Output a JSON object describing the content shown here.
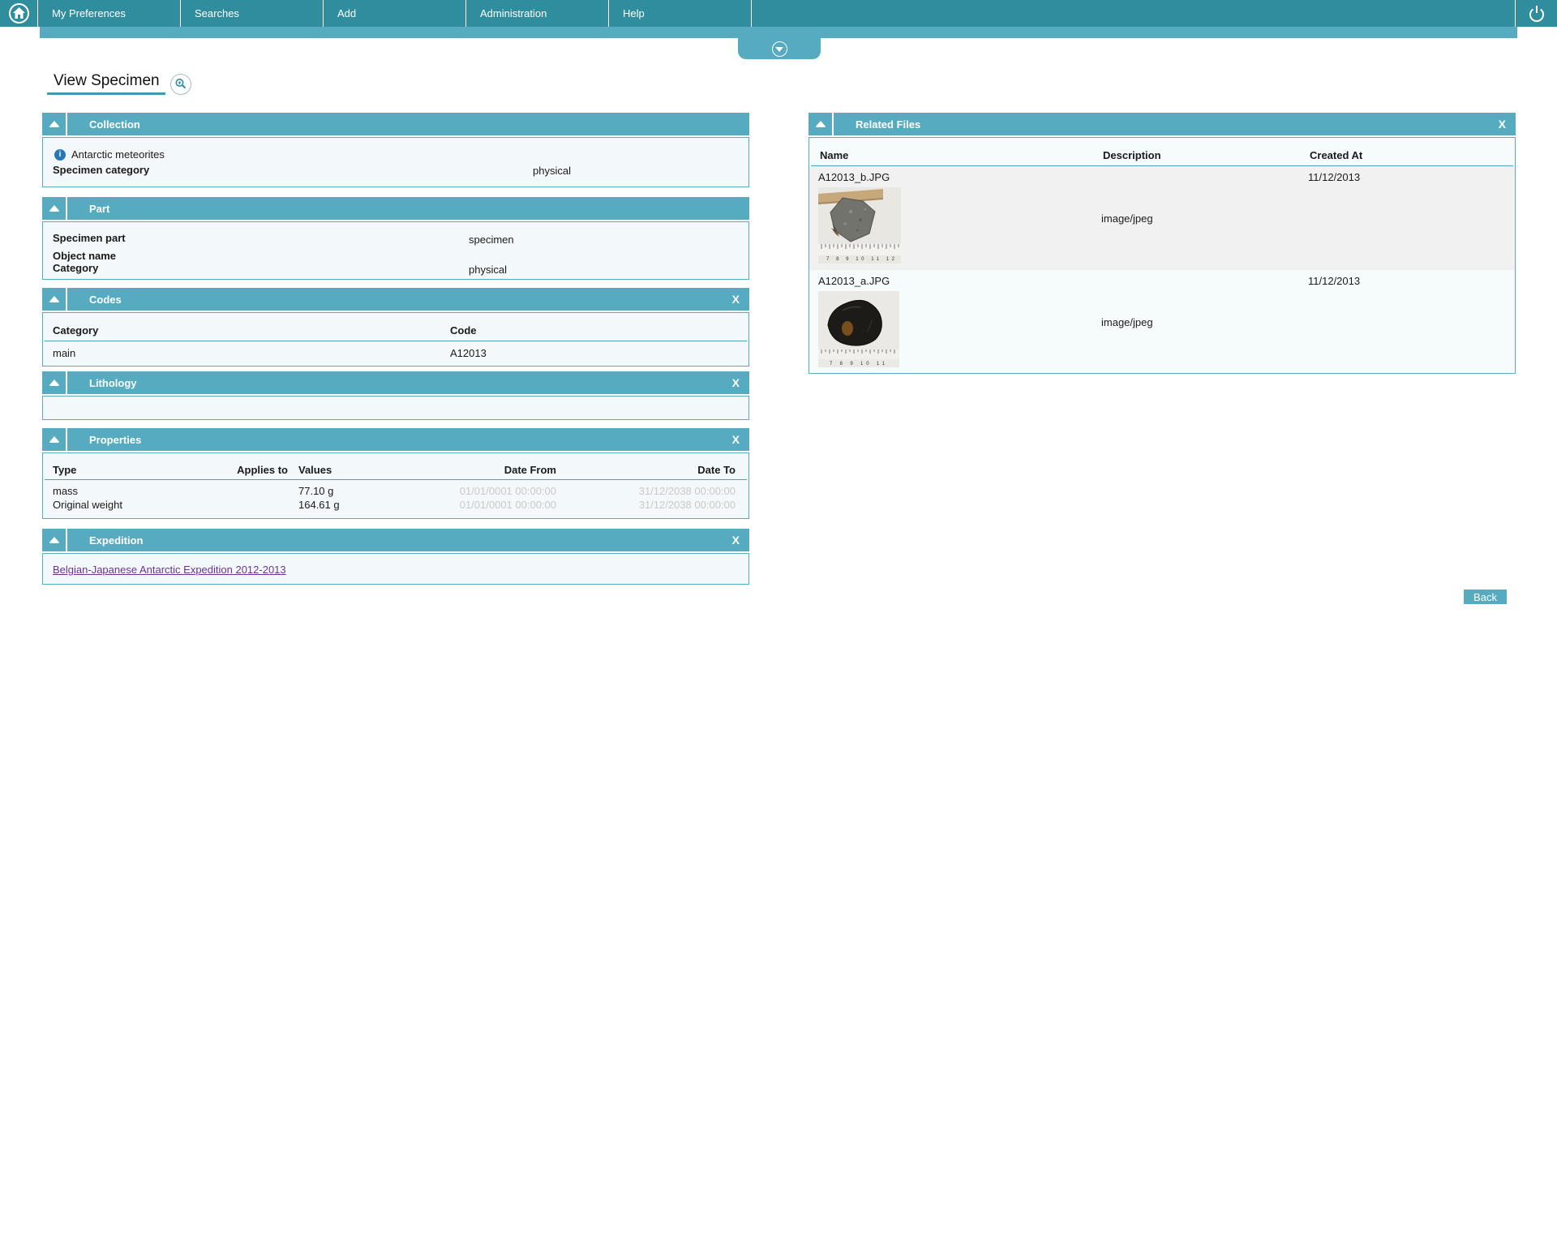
{
  "nav": {
    "items": [
      {
        "label": "My Preferences"
      },
      {
        "label": "Searches"
      },
      {
        "label": "Add"
      },
      {
        "label": "Administration"
      },
      {
        "label": "Help"
      }
    ]
  },
  "page": {
    "title": "View Specimen"
  },
  "common": {
    "close_label": "X"
  },
  "panels": {
    "collection": {
      "title": "Collection",
      "info_text": "Antarctic meteorites",
      "row": {
        "label": "Specimen category",
        "value": "physical"
      }
    },
    "part": {
      "title": "Part",
      "rows": [
        {
          "label": "Specimen part",
          "value": "specimen"
        },
        {
          "label": "Object name",
          "value": ""
        },
        {
          "label": "Category",
          "value": "physical"
        }
      ]
    },
    "codes": {
      "title": "Codes",
      "headers": [
        "Category",
        "Code"
      ],
      "rows": [
        [
          "main",
          "A12013"
        ]
      ]
    },
    "lithology": {
      "title": "Lithology"
    },
    "properties": {
      "title": "Properties",
      "headers": [
        "Type",
        "Applies to",
        "Values",
        "Date From",
        "Date To"
      ],
      "rows": [
        [
          "mass",
          "",
          "77.10 g",
          "01/01/0001 00:00:00",
          "31/12/2038 00:00:00"
        ],
        [
          "Original weight",
          "",
          "164.61 g",
          "01/01/0001 00:00:00",
          "31/12/2038 00:00:00"
        ]
      ]
    },
    "expedition": {
      "title": "Expedition",
      "link": "Belgian-Japanese Antarctic Expedition 2012-2013"
    },
    "related_files": {
      "title": "Related Files",
      "headers": [
        "Name",
        "Description",
        "Created At"
      ],
      "rows": [
        {
          "name": "A12013_b.JPG",
          "description": "image/jpeg",
          "created_at": "11/12/2013",
          "ruler": "7 8 9 10 11 12"
        },
        {
          "name": "A12013_a.JPG",
          "description": "image/jpeg",
          "created_at": "11/12/2013",
          "ruler": "7 8 9 10 11"
        }
      ]
    }
  },
  "buttons": {
    "back": "Back"
  },
  "colors": {
    "nav_teal": "#2f8d9e",
    "accent_teal": "#56abc0",
    "panel_bg": "#f3f9fa",
    "alt_row_gray": "#f1f1f1",
    "link_purple": "#6b3395",
    "muted_date_gray": "#c9c9c9",
    "info_blue": "#2878b5"
  }
}
